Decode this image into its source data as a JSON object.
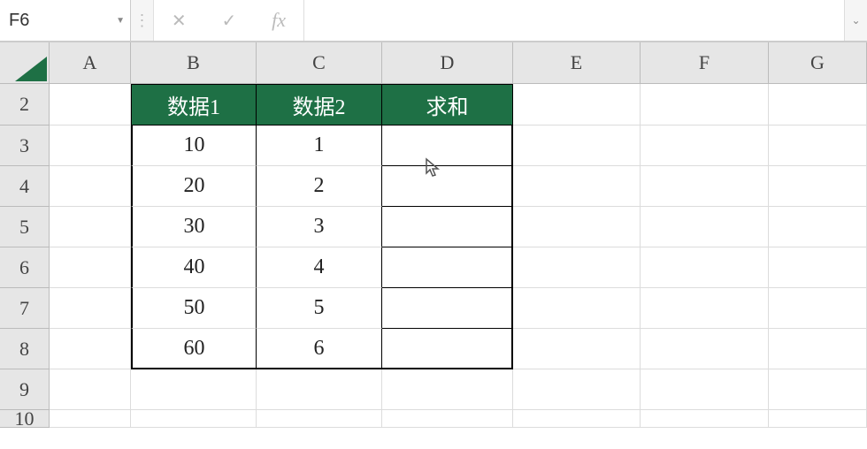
{
  "name_box": "F6",
  "formula_value": "",
  "col_headers": [
    "A",
    "B",
    "C",
    "D",
    "E",
    "F",
    "G"
  ],
  "row_headers": [
    "2",
    "3",
    "4",
    "5",
    "6",
    "7",
    "8",
    "9",
    "10"
  ],
  "table_headers": {
    "B": "数据1",
    "C": "数据2",
    "D": "求和"
  },
  "rows": [
    {
      "B": "10",
      "C": "1",
      "D": ""
    },
    {
      "B": "20",
      "C": "2",
      "D": ""
    },
    {
      "B": "30",
      "C": "3",
      "D": ""
    },
    {
      "B": "40",
      "C": "4",
      "D": ""
    },
    {
      "B": "50",
      "C": "5",
      "D": ""
    },
    {
      "B": "60",
      "C": "6",
      "D": ""
    }
  ],
  "icons": {
    "cancel": "✕",
    "confirm": "✓",
    "fx": "fx",
    "dropdown": "▼",
    "expand": "⌄",
    "dots": "⋮"
  },
  "colors": {
    "header_bg": "#1e7045",
    "header_fg": "#ffffff"
  },
  "chart_data": {
    "type": "table",
    "title": "",
    "columns": [
      "数据1",
      "数据2",
      "求和"
    ],
    "rows": [
      [
        10,
        1,
        null
      ],
      [
        20,
        2,
        null
      ],
      [
        30,
        3,
        null
      ],
      [
        40,
        4,
        null
      ],
      [
        50,
        5,
        null
      ],
      [
        60,
        6,
        null
      ]
    ]
  }
}
